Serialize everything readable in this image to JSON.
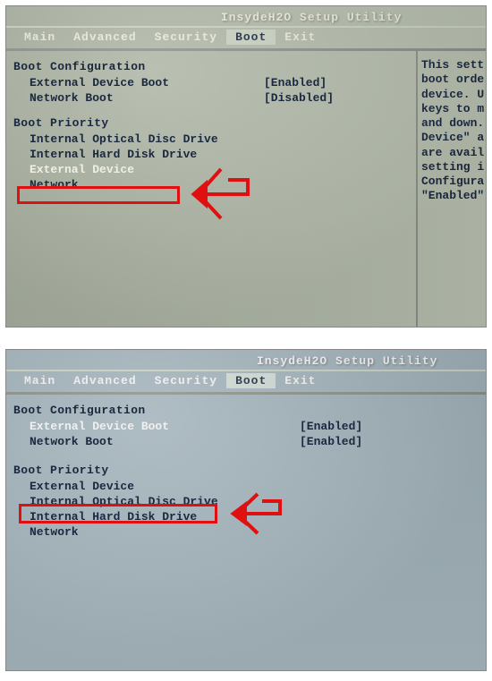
{
  "shot1": {
    "title": "InsydeH2O Setup Utility",
    "tabs": [
      "Main",
      "Advanced",
      "Security",
      "Boot",
      "Exit"
    ],
    "activeTab": 3,
    "sectionA": "Boot Configuration",
    "cfg": [
      {
        "label": "External Device Boot",
        "value": "[Enabled]"
      },
      {
        "label": "Network Boot",
        "value": "[Disabled]"
      }
    ],
    "sectionB": "Boot Priority",
    "prio": [
      "Internal Optical Disc Drive",
      "Internal Hard Disk Drive",
      "External Device",
      "Network"
    ],
    "selIndex": 2,
    "help": "This sett\nboot orde\ndevice. U\nkeys to m\nand down.\nDevice\" a\nare avail\nsetting i\nConfigura\n\"Enabled\""
  },
  "shot2": {
    "title": "InsydeH2O Setup Utility",
    "tabs": [
      "Main",
      "Advanced",
      "Security",
      "Boot",
      "Exit"
    ],
    "activeTab": 3,
    "sectionA": "Boot Configuration",
    "cfg": [
      {
        "label": "External Device Boot",
        "value": "[Enabled]"
      },
      {
        "label": "Network Boot",
        "value": "[Enabled]"
      }
    ],
    "sectionB": "Boot Priority",
    "prio": [
      "External Device",
      "Internal Optical Disc Drive",
      "Internal Hard Disk Drive",
      "Network"
    ],
    "selIndex": 0
  }
}
